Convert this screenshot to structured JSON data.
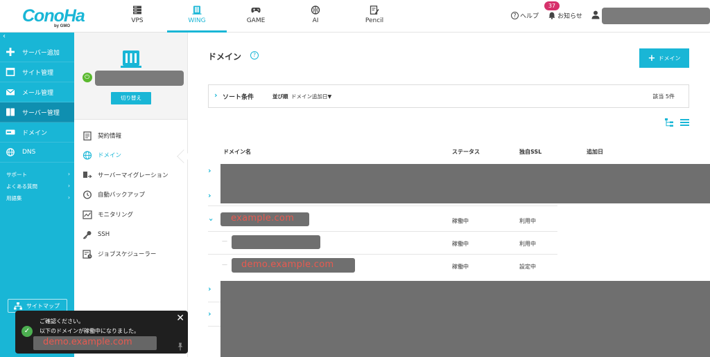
{
  "brand": {
    "logo": "ConoHa",
    "sub": "by GMO"
  },
  "nav": {
    "tabs": [
      {
        "label": "VPS",
        "icon": "server-stack-icon"
      },
      {
        "label": "WING",
        "icon": "wing-server-icon",
        "active": true
      },
      {
        "label": "GAME",
        "icon": "gamepad-icon"
      },
      {
        "label": "AI",
        "icon": "brain-icon"
      },
      {
        "label": "Pencil",
        "icon": "pencil-doc-icon"
      }
    ],
    "help": "ヘルプ",
    "notice": "お知らせ",
    "notice_count": "37"
  },
  "sidebar": {
    "items": [
      {
        "label": "サーバー追加",
        "icon": "plus-icon"
      },
      {
        "label": "サイト管理",
        "icon": "window-icon"
      },
      {
        "label": "メール管理",
        "icon": "mail-icon"
      },
      {
        "label": "サーバー管理",
        "icon": "server-icon",
        "active": true
      },
      {
        "label": "ドメイン",
        "icon": "domain-icon"
      },
      {
        "label": "DNS",
        "icon": "globe-icon"
      }
    ],
    "links": [
      {
        "label": "サポート"
      },
      {
        "label": "よくある質問"
      },
      {
        "label": "用語集"
      }
    ],
    "sitemap": "サイトマップ"
  },
  "panel": {
    "switch_label": "切り替え",
    "menu": [
      {
        "label": "契約情報",
        "icon": "contract-icon"
      },
      {
        "label": "ドメイン",
        "icon": "globe-icon",
        "active": true
      },
      {
        "label": "サーバーマイグレーション",
        "icon": "migration-icon"
      },
      {
        "label": "自動バックアップ",
        "icon": "backup-clock-icon"
      },
      {
        "label": "モニタリング",
        "icon": "monitor-chart-icon"
      },
      {
        "label": "SSH",
        "icon": "key-icon"
      },
      {
        "label": "ジョブスケジューラー",
        "icon": "scheduler-icon"
      }
    ]
  },
  "main": {
    "title": "ドメイン",
    "add_button": "ドメイン",
    "sort": {
      "label": "ソート条件",
      "order_label": "並び順",
      "order_value": "ドメイン追加日▼"
    },
    "count": "該当 5件",
    "columns": {
      "name": "ドメイン名",
      "status": "ステータス",
      "ssl": "独自SSL",
      "added": "追加日"
    },
    "rows": [
      {
        "name": "example.com",
        "status": "稼働中",
        "ssl": "利用中"
      },
      {
        "name": "",
        "status": "稼働中",
        "ssl": "利用中"
      },
      {
        "name": "demo.example.com",
        "status": "稼働中",
        "ssl": "設定中"
      }
    ]
  },
  "toast": {
    "line1": "ご確認ください。",
    "line2": "以下のドメインが稼働中になりました。",
    "domain": "demo.example.com"
  },
  "colors": {
    "accent": "#19b6d6",
    "sidebar_active": "#0f8fb0",
    "badge": "#d6316b",
    "success": "#5ab92e",
    "redaction": "#6f6f6f",
    "highlight_text": "#e85a50"
  }
}
